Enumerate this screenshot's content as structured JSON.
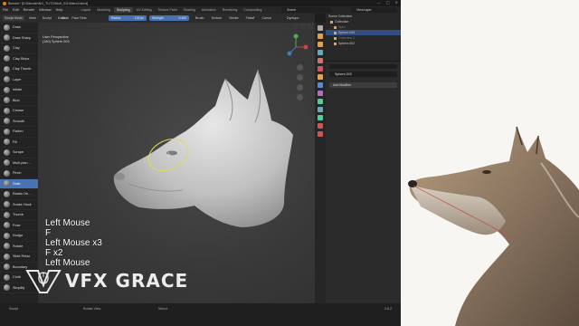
{
  "titlebar": {
    "title": "Blender* [D:\\Blender\\NO_TUTO\\Wolf_0110blend.blend]",
    "controls": [
      "—",
      "▢",
      "✕"
    ]
  },
  "menu": {
    "mode": "Sculpt Mode",
    "items": [
      "File",
      "Edit",
      "Render",
      "Window",
      "Help"
    ],
    "extra": [
      "View",
      "Sculpt",
      "Mask",
      "Face Sets"
    ],
    "workspaces": [
      "Layout",
      "Modeling",
      "Sculpting",
      "UV Editing",
      "Texture Paint",
      "Shading",
      "Animation",
      "Rendering",
      "Compositing"
    ],
    "active_workspace": "Sculpting",
    "scene": "Scene",
    "view_layer": "ViewLayer"
  },
  "tool_header": {
    "brush_name": "Grab",
    "radius_label": "Radius",
    "radius_value": "139 px",
    "strength_label": "Strength",
    "strength_value": "0.400",
    "menus": [
      "Brush",
      "Texture",
      "Stroke",
      "Falloff",
      "Cursor"
    ],
    "symmetry": "Dyntopo"
  },
  "tools": [
    {
      "label": "Draw"
    },
    {
      "label": "Draw Sharp"
    },
    {
      "label": "Clay"
    },
    {
      "label": "Clay Strips"
    },
    {
      "label": "Clay Thumb"
    },
    {
      "label": "Layer"
    },
    {
      "label": "Inflate"
    },
    {
      "label": "Blob"
    },
    {
      "label": "Crease"
    },
    {
      "label": "Smooth"
    },
    {
      "label": "Flatten"
    },
    {
      "label": "Fill"
    },
    {
      "label": "Scrape"
    },
    {
      "label": "Multi-plan…"
    },
    {
      "label": "Pinch"
    },
    {
      "label": "Grab"
    },
    {
      "label": "Elastic De…"
    },
    {
      "label": "Snake Hook"
    },
    {
      "label": "Thumb"
    },
    {
      "label": "Pose"
    },
    {
      "label": "Nudge"
    },
    {
      "label": "Rotate"
    },
    {
      "label": "Slide Relax"
    },
    {
      "label": "Boundary"
    },
    {
      "label": "Cloth"
    },
    {
      "label": "Simplify"
    }
  ],
  "active_tool": "Grab",
  "viewport": {
    "view_name": "User Perspective",
    "object_info": "(180) Sphere.003",
    "keys": [
      "Left Mouse",
      "F",
      "Left Mouse x3",
      "F x2",
      "Left Mouse"
    ]
  },
  "watermark": {
    "text": "VFX GRACE"
  },
  "outliner": {
    "title": "Scene Collection",
    "rows": [
      {
        "label": "Collection",
        "state": "normal"
      },
      {
        "label": "Sphe",
        "state": "dim"
      },
      {
        "label": "Sphere.003",
        "state": "selected"
      },
      {
        "label": "Collection 2",
        "state": "dim"
      },
      {
        "label": "Sphere.002",
        "state": "normal"
      }
    ]
  },
  "properties": {
    "object_name": "Sphere.003",
    "add_modifier_label": "Add Modifier"
  },
  "statusbar": {
    "items": [
      "Sculpt",
      "Rotate View",
      "Select"
    ],
    "version": "3.6.2"
  },
  "colors": {
    "accent_blue": "#4772b3",
    "selection_blue": "#334d80",
    "brush_circle": "#e2d95a",
    "sculpt_mesh": "#c9cac9"
  }
}
